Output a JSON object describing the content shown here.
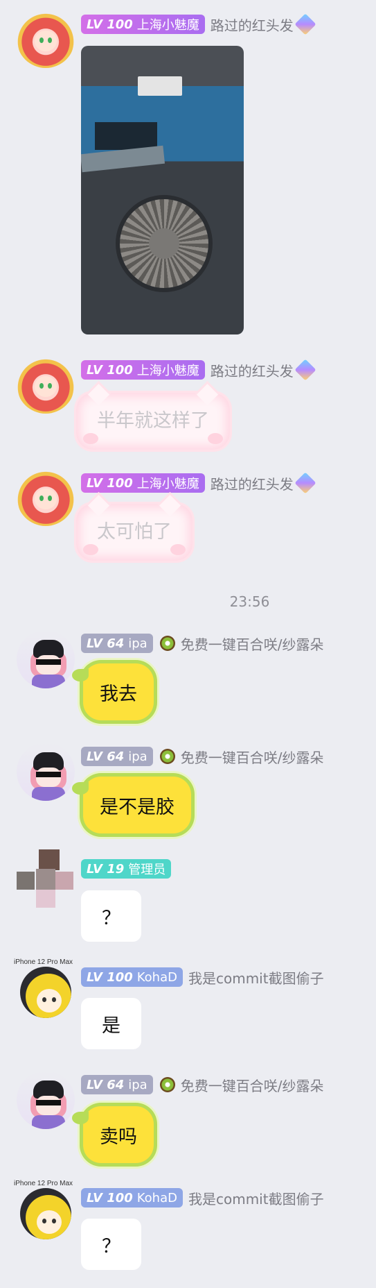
{
  "chat_time": "23:56",
  "messages": [
    {
      "sender": {
        "level": "LV 100",
        "group_title": "上海小魅魔",
        "nickname": "路过的红头发"
      },
      "type": "image",
      "image_alt": "laptop fan photo"
    },
    {
      "sender": {
        "level": "LV 100",
        "group_title": "上海小魅魔",
        "nickname": "路过的红头发"
      },
      "type": "text",
      "text": "半年就这样了"
    },
    {
      "sender": {
        "level": "LV 100",
        "group_title": "上海小魅魔",
        "nickname": "路过的红头发"
      },
      "type": "text",
      "text": "太可怕了"
    },
    {
      "sender": {
        "level": "LV 64",
        "group_title": "ipa",
        "nickname": "免费一键百合咲/纱露朵"
      },
      "type": "text",
      "text": "我去"
    },
    {
      "sender": {
        "level": "LV 64",
        "group_title": "ipa",
        "nickname": "免费一键百合咲/纱露朵"
      },
      "type": "text",
      "text": "是不是胶"
    },
    {
      "sender": {
        "level": "LV 19",
        "group_title": "管理员",
        "nickname": ""
      },
      "type": "text",
      "text": "？"
    },
    {
      "sender": {
        "device": "iPhone 12 Pro Max",
        "level": "LV 100",
        "group_title": "KohaD",
        "nickname": "我是commit截图偷子"
      },
      "type": "text",
      "text": "是"
    },
    {
      "sender": {
        "level": "LV 64",
        "group_title": "ipa",
        "nickname": "免费一键百合咲/纱露朵"
      },
      "type": "text",
      "text": "卖吗"
    },
    {
      "sender": {
        "device": "iPhone 12 Pro Max",
        "level": "LV 100",
        "group_title": "KohaD",
        "nickname": "我是commit截图偷子"
      },
      "type": "text",
      "text": "？"
    }
  ],
  "colors": {
    "background": "#ecedf2",
    "level_purple": "#c26ff0",
    "level_gray": "#a7a9c2",
    "level_teal": "#4fd6c9",
    "level_blue": "#8ea6e6",
    "lemon_bubble": "#fde13a"
  },
  "icons": [
    "diamond-badge-icon",
    "kiwi-badge-icon"
  ]
}
